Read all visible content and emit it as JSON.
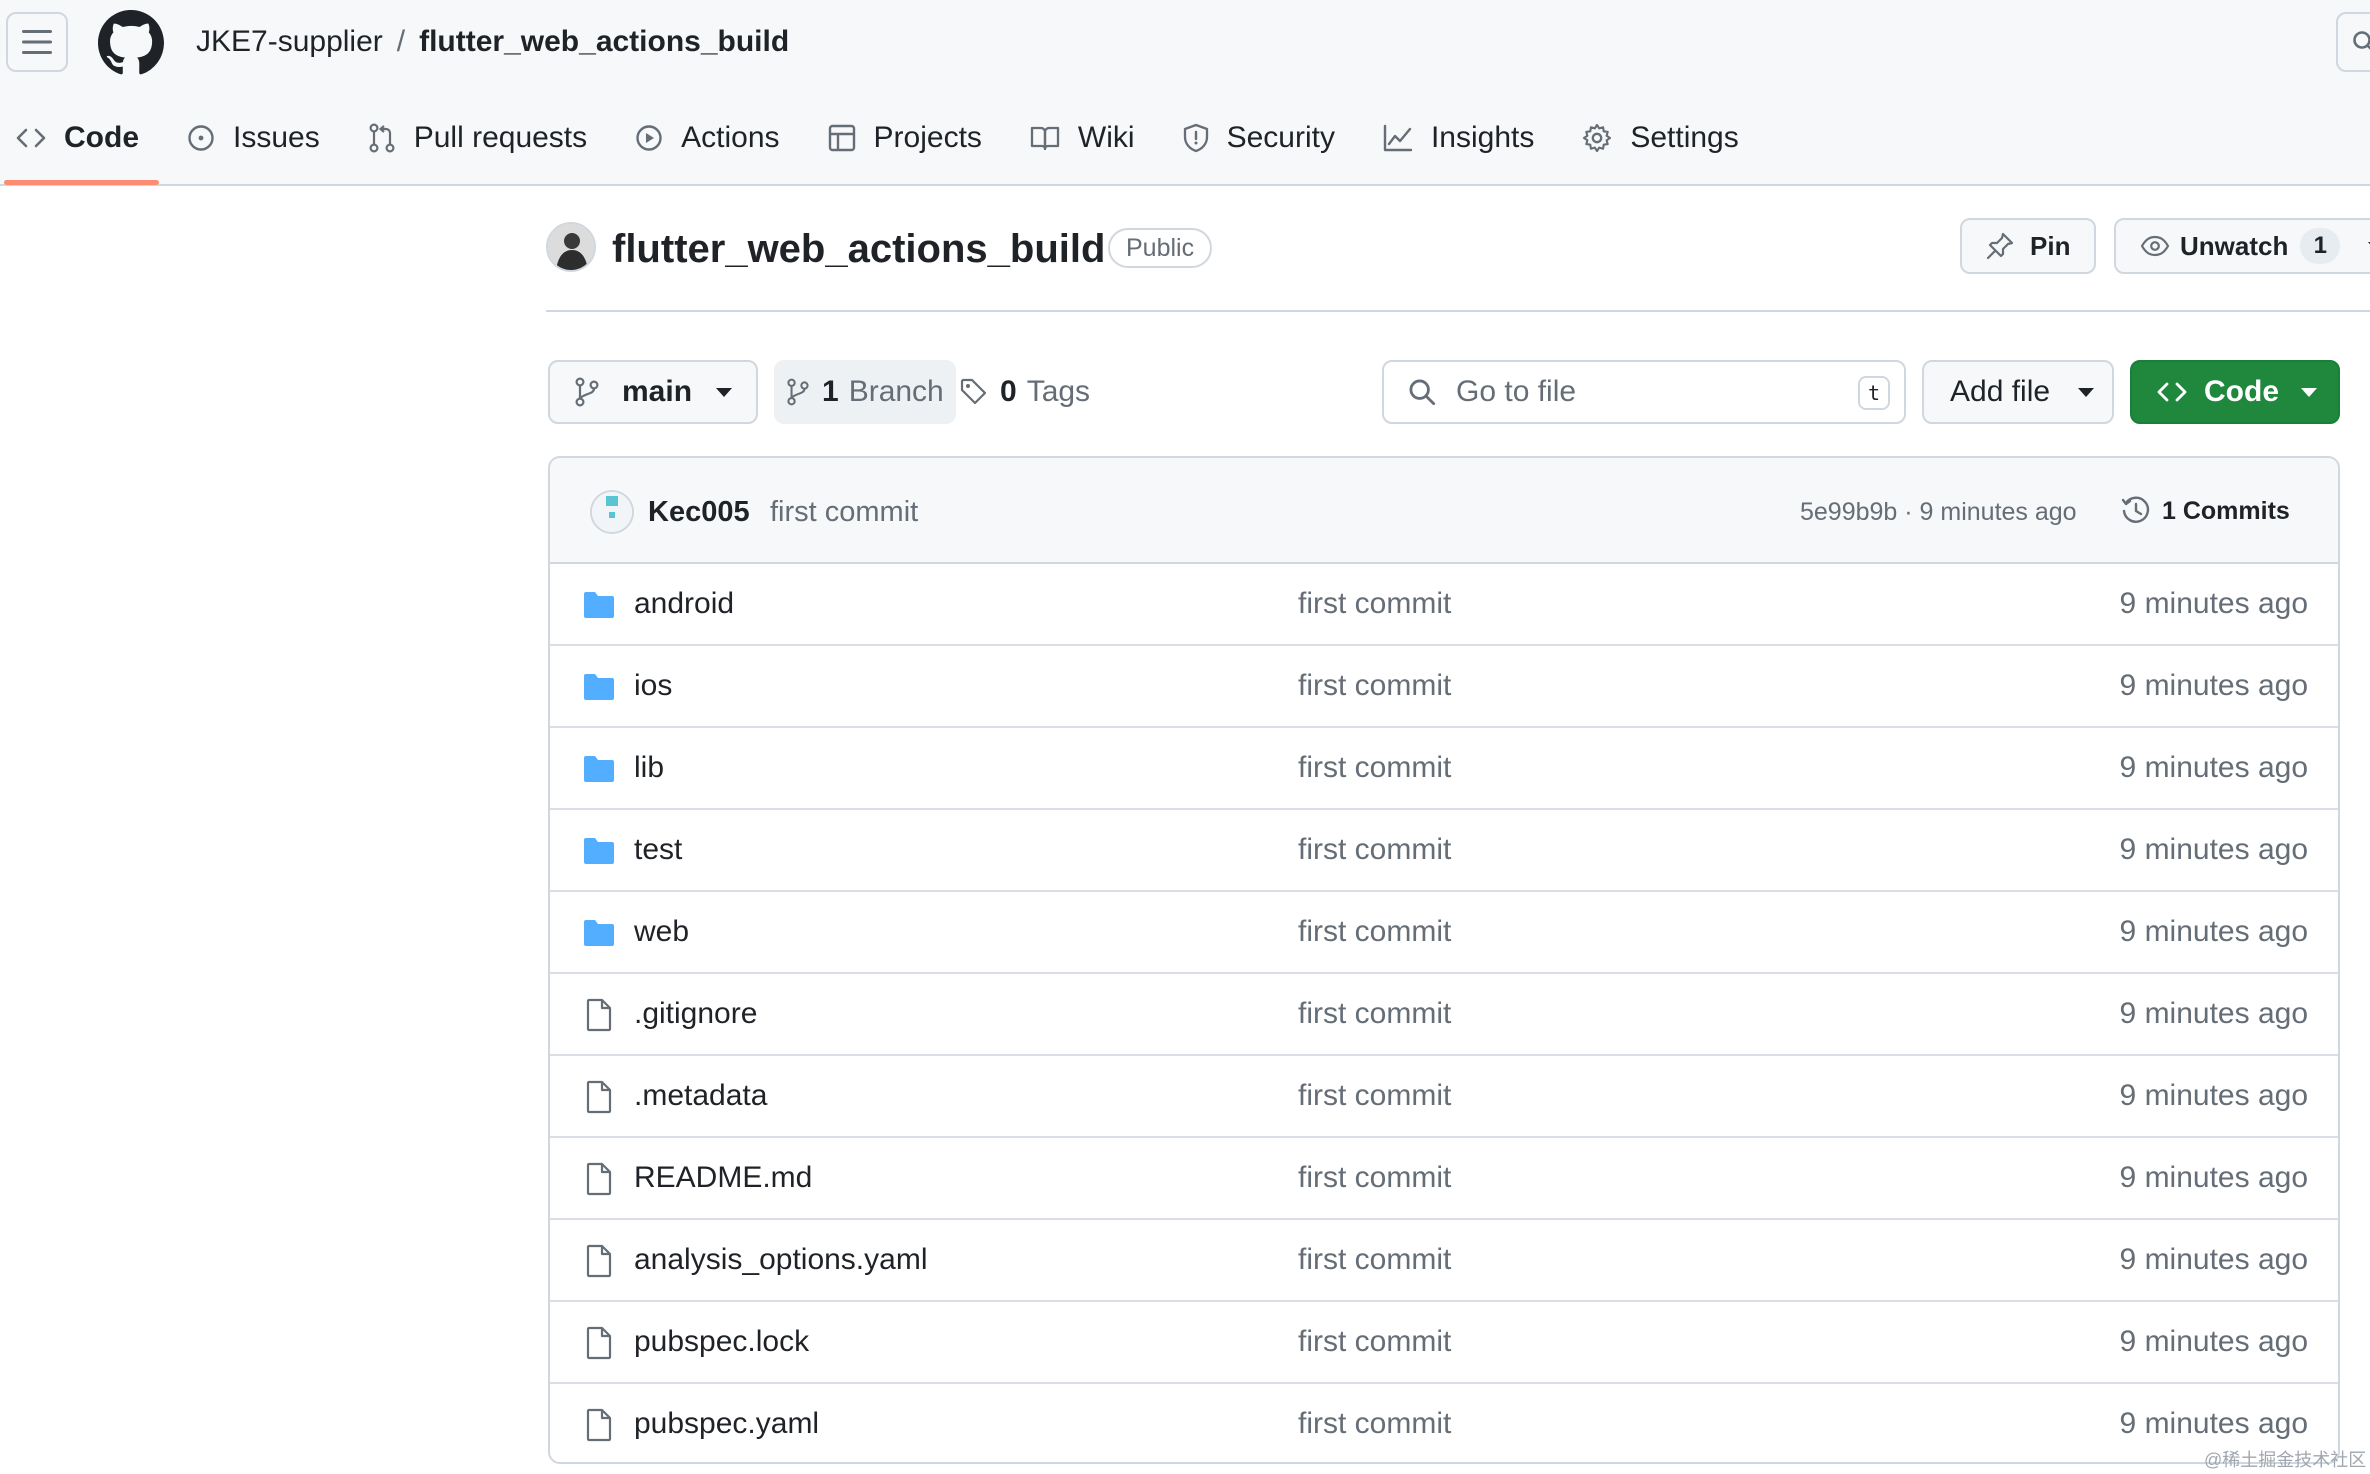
{
  "breadcrumb": {
    "owner": "JKE7-supplier",
    "separator": "/",
    "repo": "flutter_web_actions_build"
  },
  "nav": {
    "tabs": [
      {
        "label": "Code",
        "icon": "code-icon",
        "active": true
      },
      {
        "label": "Issues",
        "icon": "issue-icon"
      },
      {
        "label": "Pull requests",
        "icon": "pull-request-icon"
      },
      {
        "label": "Actions",
        "icon": "play-icon"
      },
      {
        "label": "Projects",
        "icon": "table-icon"
      },
      {
        "label": "Wiki",
        "icon": "book-icon"
      },
      {
        "label": "Security",
        "icon": "shield-icon"
      },
      {
        "label": "Insights",
        "icon": "graph-icon"
      },
      {
        "label": "Settings",
        "icon": "gear-icon"
      }
    ]
  },
  "repo": {
    "title": "flutter_web_actions_build",
    "visibility": "Public"
  },
  "actions": {
    "pin_label": "Pin",
    "watch_label": "Unwatch",
    "watch_count": "1"
  },
  "toolbar": {
    "branch": "main",
    "branches_count": "1",
    "branches_label": "Branch",
    "tags_count": "0",
    "tags_label": "Tags",
    "goto_placeholder": "Go to file",
    "goto_shortcut": "t",
    "add_file_label": "Add file",
    "code_label": "Code"
  },
  "latest_commit": {
    "author": "Kec005",
    "message": "first commit",
    "hash_time": "5e99b9b · 9 minutes ago",
    "commits_label": "1 Commits"
  },
  "files": [
    {
      "name": "android",
      "type": "dir",
      "message": "first commit",
      "age": "9 minutes ago"
    },
    {
      "name": "ios",
      "type": "dir",
      "message": "first commit",
      "age": "9 minutes ago"
    },
    {
      "name": "lib",
      "type": "dir",
      "message": "first commit",
      "age": "9 minutes ago"
    },
    {
      "name": "test",
      "type": "dir",
      "message": "first commit",
      "age": "9 minutes ago"
    },
    {
      "name": "web",
      "type": "dir",
      "message": "first commit",
      "age": "9 minutes ago"
    },
    {
      "name": ".gitignore",
      "type": "file",
      "message": "first commit",
      "age": "9 minutes ago"
    },
    {
      "name": ".metadata",
      "type": "file",
      "message": "first commit",
      "age": "9 minutes ago"
    },
    {
      "name": "README.md",
      "type": "file",
      "message": "first commit",
      "age": "9 minutes ago"
    },
    {
      "name": "analysis_options.yaml",
      "type": "file",
      "message": "first commit",
      "age": "9 minutes ago"
    },
    {
      "name": "pubspec.lock",
      "type": "file",
      "message": "first commit",
      "age": "9 minutes ago"
    },
    {
      "name": "pubspec.yaml",
      "type": "file",
      "message": "first commit",
      "age": "9 minutes ago"
    }
  ],
  "watermark": "@稀土掘金技术社区",
  "colors": {
    "accent_underline": "#fd8c73",
    "primary_button": "#1f883d",
    "folder": "#54aeff",
    "muted_text": "#656d76"
  }
}
